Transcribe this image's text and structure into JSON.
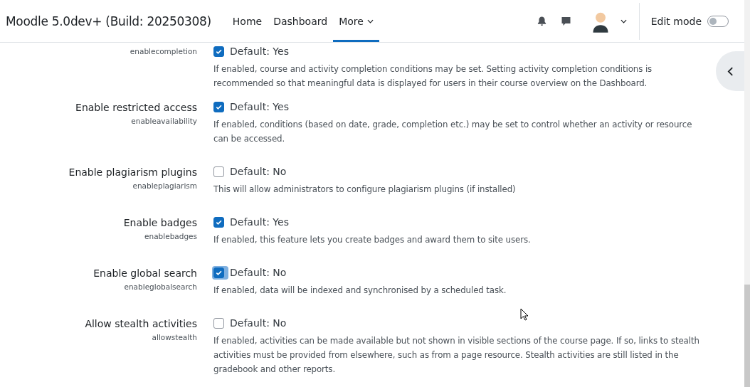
{
  "header": {
    "site_name": "Moodle 5.0dev+ (Build: 20250308)",
    "nav": [
      {
        "label": "Home",
        "selected": false,
        "kind": "link"
      },
      {
        "label": "Dashboard",
        "selected": false,
        "kind": "link"
      },
      {
        "label": "More",
        "selected": true,
        "kind": "menu"
      }
    ],
    "edit_mode": {
      "label": "Edit mode",
      "on": false
    }
  },
  "settings": [
    {
      "key": "enablecompletion",
      "checked": true,
      "focused": false,
      "default": "Default: Yes",
      "description": "If enabled, course and activity completion conditions may be set. Setting activity completion conditions is recommended so that meaningful data is displayed for users in their course overview on the Dashboard."
    },
    {
      "label": "Enable restricted access",
      "key": "enableavailability",
      "checked": true,
      "focused": false,
      "default": "Default: Yes",
      "description": "If enabled, conditions (based on date, grade, completion etc.) may be set to control whether an activity or resource can be accessed."
    },
    {
      "label": "Enable plagiarism plugins",
      "key": "enableplagiarism",
      "checked": false,
      "focused": false,
      "default": "Default: No",
      "description": "This will allow administrators to configure plagiarism plugins (if installed)"
    },
    {
      "label": "Enable badges",
      "key": "enablebadges",
      "checked": true,
      "focused": false,
      "default": "Default: Yes",
      "description": "If enabled, this feature lets you create badges and award them to site users."
    },
    {
      "label": "Enable global search",
      "key": "enableglobalsearch",
      "checked": true,
      "focused": true,
      "default": "Default: No",
      "description": "If enabled, data will be indexed and synchronised by a scheduled task."
    },
    {
      "label": "Allow stealth activities",
      "key": "allowstealth",
      "checked": false,
      "focused": false,
      "default": "Default: No",
      "description": "If enabled, activities can be made available but not shown in visible sections of the course page. If so, links to stealth activities must be provided from elsewhere, such as from a page resource. Stealth activities are still listed in the gradebook and other reports."
    }
  ]
}
